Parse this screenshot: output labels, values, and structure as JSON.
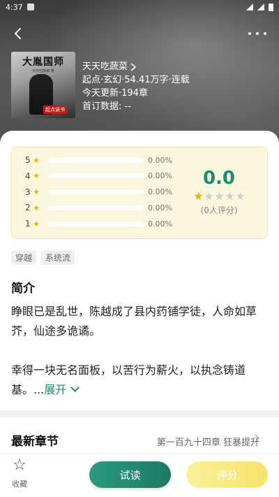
{
  "status_bar": {
    "time": "4:37"
  },
  "book": {
    "cover_title": "大胤国师",
    "cover_subtitle": "天天吃蔬菜 著",
    "cover_badge": "起点读书",
    "author": "天天吃蔬菜",
    "category_line": "起点·玄幻·54.41万字·连载",
    "update_line": "今天更新·194章",
    "first_sub_line": "首订数据: --"
  },
  "rating": {
    "rows": [
      {
        "level": "5",
        "percent": "0.00%",
        "fraction": 0
      },
      {
        "level": "4",
        "percent": "0.00%",
        "fraction": 0
      },
      {
        "level": "3",
        "percent": "0.00%",
        "fraction": 0
      },
      {
        "level": "2",
        "percent": "0.00%",
        "fraction": 0
      },
      {
        "level": "1",
        "percent": "0.00%",
        "fraction": 0
      }
    ],
    "score": "0.0",
    "stars_filled": 0.5,
    "votes": "(0人评分)"
  },
  "tags": [
    "穿越",
    "系统流"
  ],
  "intro": {
    "title": "简介",
    "para1": "睁眼已是乱世，陈越成了县内药铺学徒，人命如草芥，仙途多诡谲。",
    "para2": "幸得一块无名面板，以苦行为薪火，以执念铸道基。...",
    "expand_label": "展开"
  },
  "latest": {
    "title": "最新章节",
    "chapter": "第一百九十四章 狂暴提升"
  },
  "bottom": {
    "favorite_label": "收藏",
    "read_label": "试读",
    "rate_label": "评分"
  },
  "colors": {
    "accent_green": "#1f8b6e",
    "star_yellow": "#f5b400",
    "rating_bg": "#fbf7df"
  }
}
